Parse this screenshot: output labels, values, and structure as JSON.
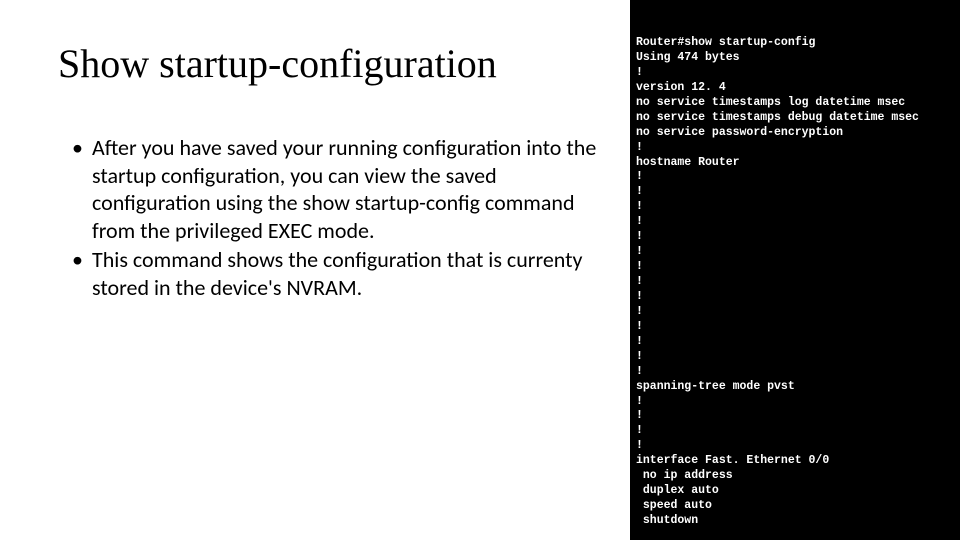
{
  "slide": {
    "title": "Show startup-configuration",
    "bullets": [
      "After you have saved your running configuration into the startup configuration, you can view the saved configuration using the show startup-config command from the privileged EXEC mode.",
      "This command shows the configuration that is currenty stored in the device's NVRAM."
    ]
  },
  "terminal": {
    "lines": [
      "Router#show startup-config",
      "Using 474 bytes",
      "!",
      "version 12. 4",
      "no service timestamps log datetime msec",
      "no service timestamps debug datetime msec",
      "no service password-encryption",
      "!",
      "hostname Router",
      "!",
      "!",
      "!",
      "!",
      "!",
      "!",
      "!",
      "!",
      "!",
      "!",
      "!",
      "!",
      "!",
      "!",
      "spanning-tree mode pvst",
      "!",
      "!",
      "!",
      "!",
      "interface Fast. Ethernet 0/0",
      " no ip address",
      " duplex auto",
      " speed auto",
      " shutdown"
    ]
  }
}
